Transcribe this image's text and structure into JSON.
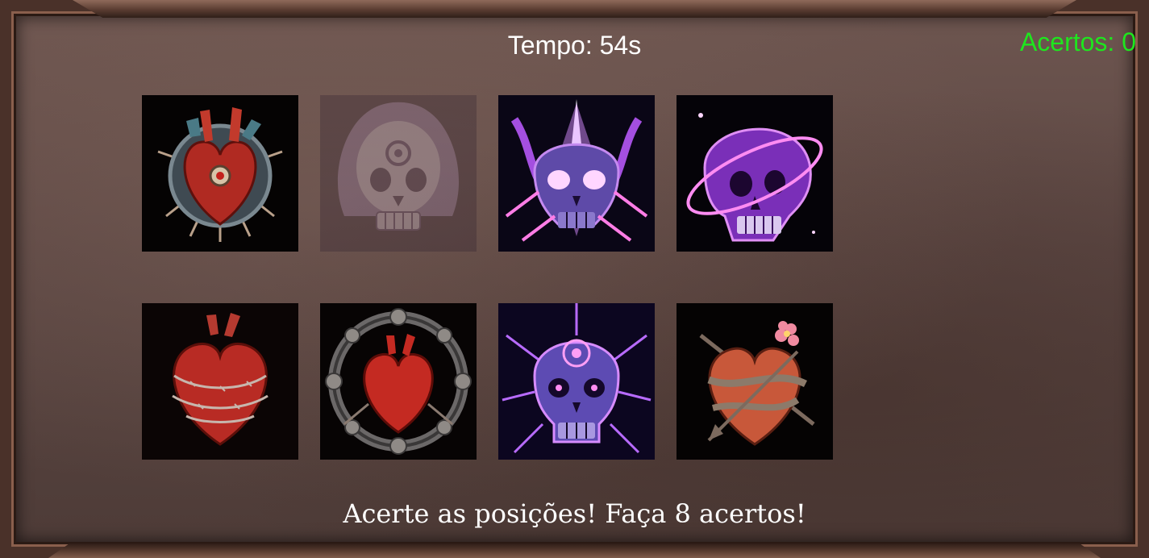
{
  "hud": {
    "timer_text": "Tempo: 54s",
    "score_text": "Acertos: 0",
    "score_color": "#1ee61e"
  },
  "instruction": "Acerte as posições! Faça 8 acertos!",
  "cards": [
    {
      "icon": "mechanical-heart-icon",
      "state": "revealed"
    },
    {
      "icon": "faded-purple-skull-icon",
      "state": "faded"
    },
    {
      "icon": "horned-purple-skull-icon",
      "state": "revealed"
    },
    {
      "icon": "orbit-skull-icon",
      "state": "revealed"
    },
    {
      "icon": "barbed-wire-heart-icon",
      "state": "revealed"
    },
    {
      "icon": "rune-circle-heart-icon",
      "state": "revealed"
    },
    {
      "icon": "lightning-skull-icon",
      "state": "revealed"
    },
    {
      "icon": "pierced-flower-heart-icon",
      "state": "revealed"
    }
  ]
}
